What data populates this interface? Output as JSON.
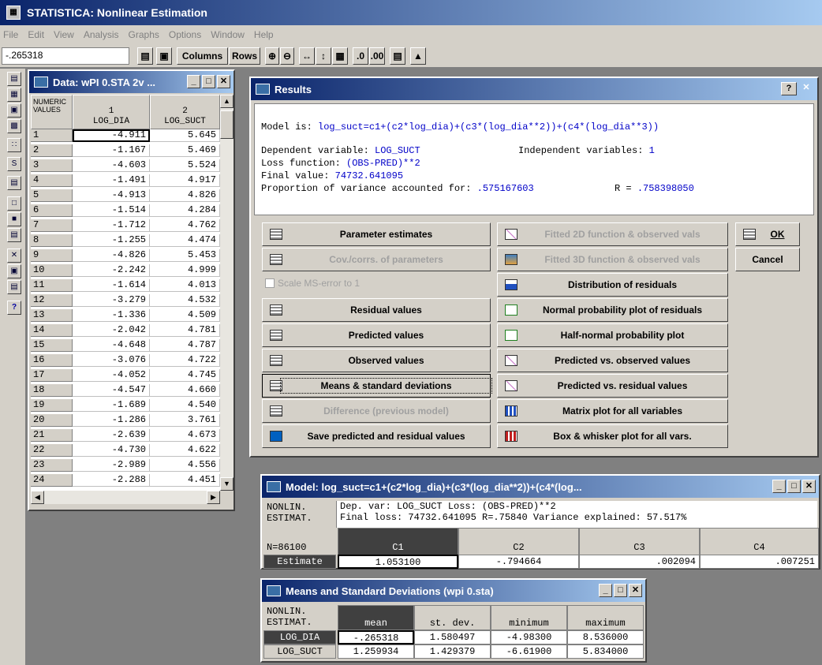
{
  "app": {
    "title": "STATISTICA: Nonlinear Estimation"
  },
  "menu": [
    "File",
    "Edit",
    "View",
    "Analysis",
    "Graphs",
    "Options",
    "Window",
    "Help"
  ],
  "toolbar": {
    "cell_value": "-.265318",
    "columns_label": "Columns",
    "rows_label": "Rows"
  },
  "data_window": {
    "title": "Data: wPI 0.STA 2v ...",
    "corner_label": "NUMERIC VALUES",
    "col1": {
      "num": "1",
      "name": "LOG_DIA"
    },
    "col2": {
      "num": "2",
      "name": "LOG_SUCT"
    },
    "rows": [
      [
        "1",
        "-4.911",
        "5.645"
      ],
      [
        "2",
        "-1.167",
        "5.469"
      ],
      [
        "3",
        "-4.603",
        "5.524"
      ],
      [
        "4",
        "-1.491",
        "4.917"
      ],
      [
        "5",
        "-4.913",
        "4.826"
      ],
      [
        "6",
        "-1.514",
        "4.284"
      ],
      [
        "7",
        "-1.712",
        "4.762"
      ],
      [
        "8",
        "-1.255",
        "4.474"
      ],
      [
        "9",
        "-4.826",
        "5.453"
      ],
      [
        "10",
        "-2.242",
        "4.999"
      ],
      [
        "11",
        "-1.614",
        "4.013"
      ],
      [
        "12",
        "-3.279",
        "4.532"
      ],
      [
        "13",
        "-1.336",
        "4.509"
      ],
      [
        "14",
        "-2.042",
        "4.781"
      ],
      [
        "15",
        "-4.648",
        "4.787"
      ],
      [
        "16",
        "-3.076",
        "4.722"
      ],
      [
        "17",
        "-4.052",
        "4.745"
      ],
      [
        "18",
        "-4.547",
        "4.660"
      ],
      [
        "19",
        "-1.689",
        "4.540"
      ],
      [
        "20",
        "-1.286",
        "3.761"
      ],
      [
        "21",
        "-2.639",
        "4.673"
      ],
      [
        "22",
        "-4.730",
        "4.622"
      ],
      [
        "23",
        "-2.989",
        "4.556"
      ],
      [
        "24",
        "-2.288",
        "4.451"
      ]
    ]
  },
  "results": {
    "title": "Results",
    "model_label": "Model is: ",
    "model": "log_suct=c1+(c2*log_dia)+(c3*(log_dia**2))+(c4*(log_dia**3))",
    "dep_label": "Dependent variable: ",
    "dep_value": "LOG_SUCT",
    "indep_label": "Independent variables: ",
    "indep_value": "1",
    "loss_label": "Loss function: ",
    "loss_value": "(OBS-PRED)**2",
    "final_label": "Final value: ",
    "final_value": "74732.641095",
    "prop_label": "Proportion of variance accounted for: ",
    "prop_value": ".575167603",
    "r_label": "R = ",
    "r_value": ".758398050",
    "buttons": {
      "param": "Parameter estimates",
      "cov": "Cov./corrs. of parameters",
      "scale": "Scale MS-error to 1",
      "resid": "Residual values",
      "pred": "Predicted values",
      "obs": "Observed values",
      "means": "Means & standard deviations",
      "diff": "Difference (previous model)",
      "save": "Save predicted and residual values",
      "f2d": "Fitted 2D function & observed vals",
      "f3d": "Fitted 3D function & observed vals",
      "dist": "Distribution of residuals",
      "normal": "Normal probability plot of residuals",
      "half": "Half-normal probability plot",
      "pvo": "Predicted vs. observed values",
      "pvr": "Predicted vs. residual values",
      "matrix": "Matrix plot for all variables",
      "box": "Box & whisker plot for all vars.",
      "ok": "OK",
      "cancel": "Cancel"
    }
  },
  "model_window": {
    "title": "Model: log_suct=c1+(c2*log_dia)+(c3*(log_dia**2))+(c4*(log...",
    "corner": "NONLIN.\nESTIMAT.",
    "info1": "Dep. var: LOG_SUCT Loss: (OBS-PRED)**2",
    "info2": "Final loss: 74732.641095 R=.75840 Variance explained: 57.517%",
    "n": "N=86100",
    "cols": [
      "C1",
      "C2",
      "C3",
      "C4"
    ],
    "row_label": "Estimate",
    "values": [
      "1.053100",
      "-.794664",
      ".002094",
      ".007251"
    ]
  },
  "means_window": {
    "title": "Means and Standard Deviations (wpi 0.sta)",
    "corner": "NONLIN.\nESTIMAT.",
    "cols": [
      "mean",
      "st. dev.",
      "minimum",
      "maximum"
    ],
    "rows": [
      {
        "label": "LOG_DIA",
        "values": [
          "-.265318",
          "1.580497",
          "-4.98300",
          "8.536000"
        ]
      },
      {
        "label": "LOG_SUCT",
        "values": [
          "1.259934",
          "1.429379",
          "-6.61900",
          "5.834000"
        ]
      }
    ]
  }
}
